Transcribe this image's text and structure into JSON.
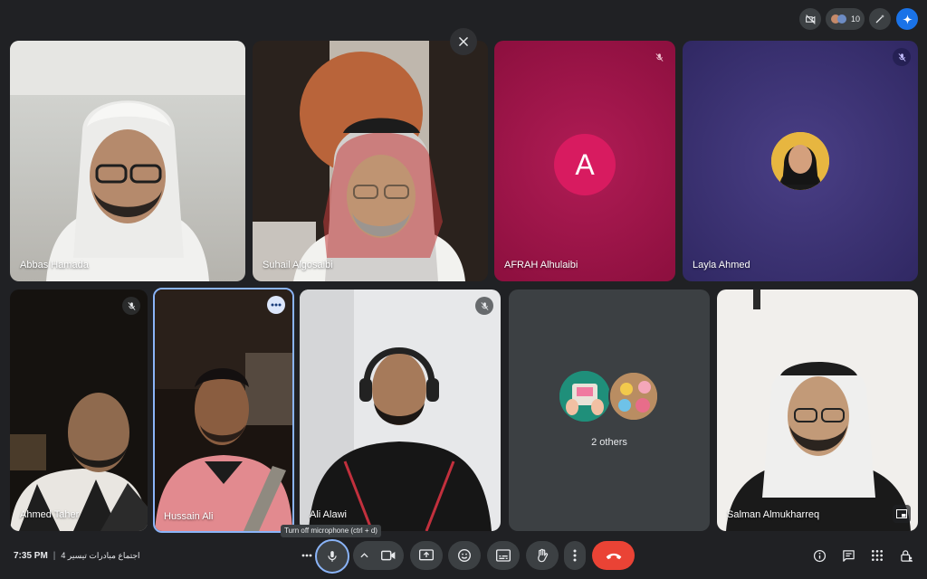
{
  "top_bar": {
    "participant_count": "10"
  },
  "tiles": [
    {
      "name": "Abbas Hamada"
    },
    {
      "name": "Suhail Algosaibi"
    },
    {
      "name": "AFRAH Alhulaibi",
      "initial": "A",
      "bg": "#a5144a"
    },
    {
      "name": "Layla Ahmed",
      "bg": "#3b3270"
    },
    {
      "name": "Ahmed Taher"
    },
    {
      "name": "Hussain Ali"
    },
    {
      "name": "Ali Alawi"
    },
    {
      "name": "2 others"
    },
    {
      "name": "Salman Almukharreq"
    }
  ],
  "bottom_bar": {
    "time": "7:35 PM",
    "separator": "|",
    "meeting_title": "اجتماع مبادرات تيسير 4",
    "mic_tooltip": "Turn off microphone (ctrl + d)"
  },
  "colors": {
    "end_call": "#ea4335",
    "active_speaker": "#8ab4f8",
    "app_bg": "#202124"
  }
}
